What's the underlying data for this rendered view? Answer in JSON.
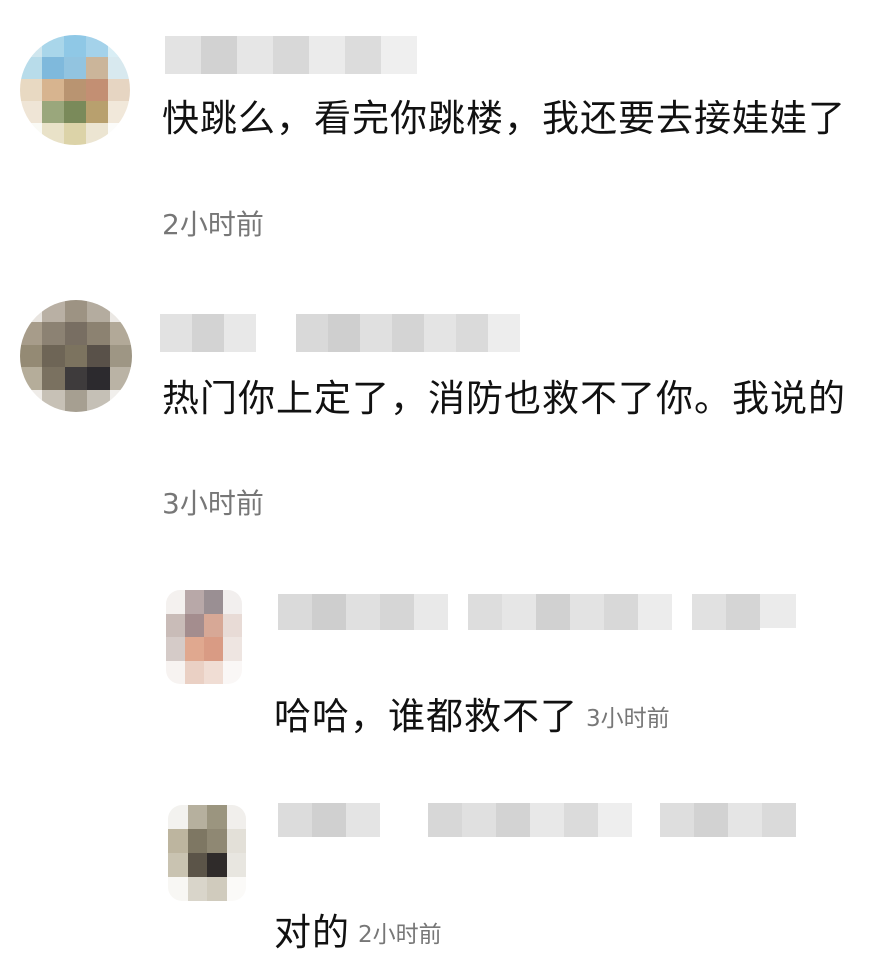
{
  "comments": [
    {
      "text": "快跳么，看完你跳楼，我还要去接娃娃了",
      "time": "2小时前"
    },
    {
      "text": "热门你上定了，消防也救不了你。我说的",
      "time": "3小时前"
    }
  ],
  "replies": [
    {
      "text": "哈哈，谁都救不了",
      "time": "3小时前"
    },
    {
      "text": "对的",
      "time": "2小时前"
    }
  ],
  "colors": {
    "background": "#ffffff",
    "text": "#111111",
    "time": "#777777"
  },
  "icons": {
    "avatar": "pixelated-avatar-image",
    "username": "pixelated-username-image"
  }
}
